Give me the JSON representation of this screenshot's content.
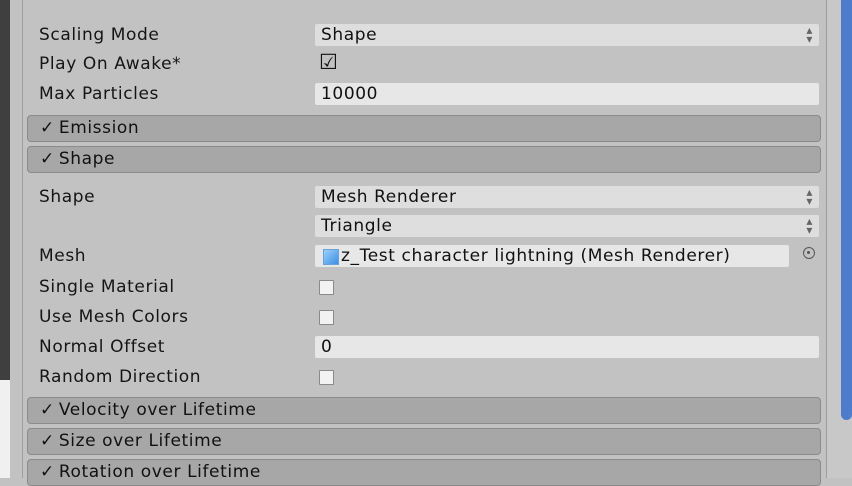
{
  "main_module": {
    "rows": {
      "scaling_mode": {
        "label": "Scaling Mode",
        "value": "Shape"
      },
      "play_on_awake": {
        "label": "Play On Awake*",
        "checked": true
      },
      "max_particles": {
        "label": "Max Particles",
        "value": "10000"
      }
    }
  },
  "modules": {
    "emission": {
      "title": "Emission",
      "enabled": true
    },
    "shape": {
      "title": "Shape",
      "enabled": true
    },
    "velocity": {
      "title": "Velocity over Lifetime",
      "enabled": true
    },
    "size": {
      "title": "Size over Lifetime",
      "enabled": true
    },
    "rotation": {
      "title": "Rotation over Lifetime",
      "enabled": true
    }
  },
  "shape_module": {
    "shape": {
      "label": "Shape",
      "value": "Mesh Renderer"
    },
    "mesh_type": {
      "value": "Triangle"
    },
    "mesh": {
      "label": "Mesh",
      "value": "z_Test character lightning (Mesh Renderer)",
      "icon": "mesh-icon"
    },
    "single_material": {
      "label": "Single Material",
      "checked": false
    },
    "use_mesh_colors": {
      "label": "Use Mesh Colors",
      "checked": false
    },
    "normal_offset": {
      "label": "Normal Offset",
      "value": "0"
    },
    "random_direction": {
      "label": "Random Direction",
      "checked": false
    }
  },
  "glyphs": {
    "check": "✓",
    "check_box_on": "☑",
    "dropdown_arrows": "⇕",
    "object_picker": "target-icon"
  },
  "colors": {
    "panel_bg": "#c2c2c2",
    "field_bg": "#e7e7e7",
    "module_header_bg": "#a7a7a7",
    "scroll_thumb": "#4e7ccc"
  }
}
